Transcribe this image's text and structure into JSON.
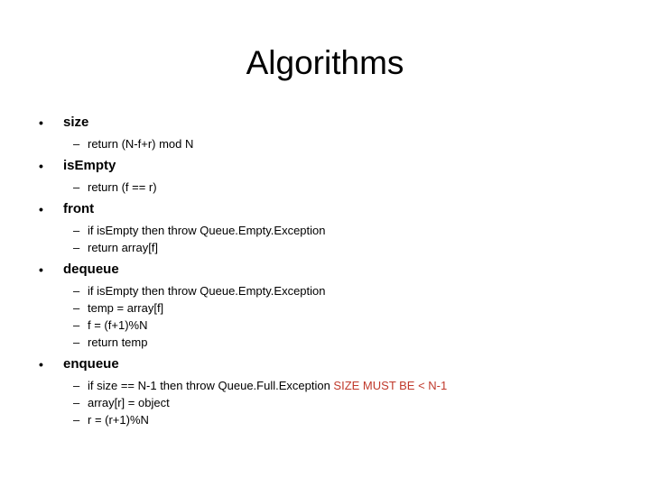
{
  "slide": {
    "title": "Algorithms",
    "bullet_glyph": "•",
    "dash_glyph": "–",
    "accent_red": "#c0392b",
    "text_color": "#000000",
    "background": "#ffffff",
    "sections": [
      {
        "label": "size",
        "lines": [
          {
            "text": "return (N-f+r) mod N",
            "note": ""
          }
        ]
      },
      {
        "label": "isEmpty",
        "lines": [
          {
            "text": "return (f == r)",
            "note": ""
          }
        ]
      },
      {
        "label": "front",
        "lines": [
          {
            "text": "if isEmpty then throw Queue.Empty.Exception",
            "note": ""
          },
          {
            "text": "return array[f]",
            "note": ""
          }
        ]
      },
      {
        "label": "dequeue",
        "lines": [
          {
            "text": "if isEmpty then throw Queue.Empty.Exception",
            "note": ""
          },
          {
            "text": "temp = array[f]",
            "note": ""
          },
          {
            "text": "f = (f+1)%N",
            "note": ""
          },
          {
            "text": "return temp",
            "note": ""
          }
        ]
      },
      {
        "label": "enqueue",
        "lines": [
          {
            "text": "if size == N-1 then throw Queue.Full.Exception",
            "note": "SIZE MUST BE < N-1"
          },
          {
            "text": "array[r] = object",
            "note": ""
          },
          {
            "text": "r = (r+1)%N",
            "note": ""
          }
        ]
      }
    ]
  }
}
